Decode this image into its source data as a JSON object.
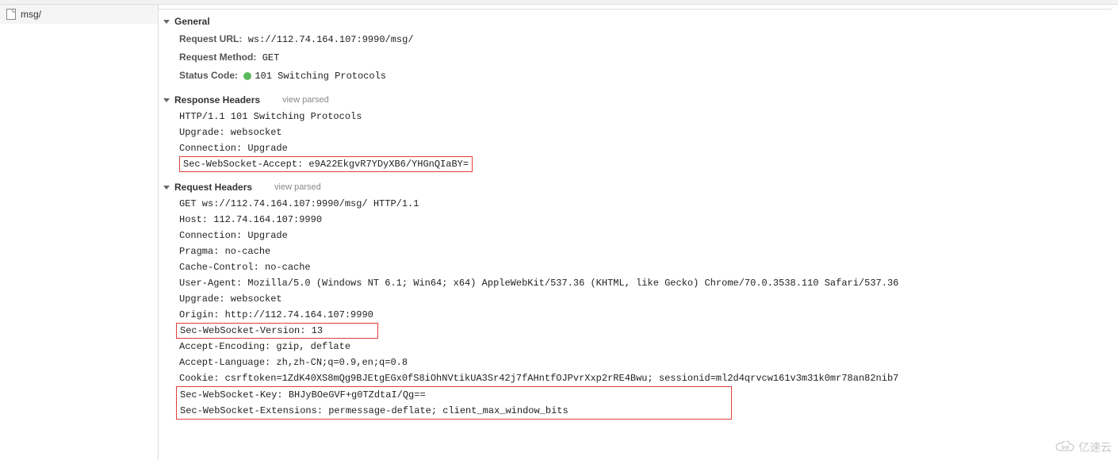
{
  "sidebar": {
    "item_label": "msg/"
  },
  "sections": {
    "general": {
      "title": "General",
      "request_url_key": "Request URL:",
      "request_url_val": "ws://112.74.164.107:9990/msg/",
      "request_method_key": "Request Method:",
      "request_method_val": "GET",
      "status_code_key": "Status Code:",
      "status_code_val": "101 Switching Protocols"
    },
    "response": {
      "title": "Response Headers",
      "view_parsed": "view parsed",
      "lines": [
        "HTTP/1.1 101 Switching Protocols",
        "Upgrade: websocket",
        "Connection: Upgrade"
      ],
      "highlighted": "Sec-WebSocket-Accept: e9A22EkgvR7YDyXB6/YHGnQIaBY="
    },
    "request": {
      "title": "Request Headers",
      "view_parsed": "view parsed",
      "lines_a": [
        "GET ws://112.74.164.107:9990/msg/ HTTP/1.1",
        "Host: 112.74.164.107:9990",
        "Connection: Upgrade",
        "Pragma: no-cache",
        "Cache-Control: no-cache",
        "User-Agent: Mozilla/5.0 (Windows NT 6.1; Win64; x64) AppleWebKit/537.36 (KHTML, like Gecko) Chrome/70.0.3538.110 Safari/537.36",
        "Upgrade: websocket",
        "Origin: http://112.74.164.107:9990"
      ],
      "highlighted_mid": "Sec-WebSocket-Version: 13",
      "lines_b": [
        "Accept-Encoding: gzip, deflate",
        "Accept-Language: zh,zh-CN;q=0.9,en;q=0.8",
        "Cookie: csrftoken=1ZdK40XS8mQg9BJEtgEGx0fS8iOhNVtikUA3Sr42j7fAHntfOJPvrXxp2rRE4Bwu; sessionid=ml2d4qrvcw161v3m31k0mr78an82nib7"
      ],
      "highlighted_bottom": [
        "Sec-WebSocket-Key: BHJyBOeGVF+g0TZdtaI/Qg==",
        "Sec-WebSocket-Extensions: permessage-deflate; client_max_window_bits"
      ]
    }
  },
  "watermark": "亿速云"
}
